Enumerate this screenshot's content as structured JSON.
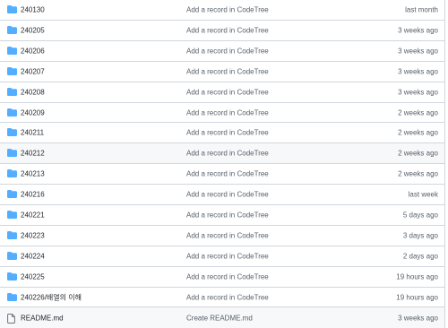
{
  "colors": {
    "folder": "#54aeff",
    "file": "#57606a",
    "border": "#d0d7de"
  },
  "rows": [
    {
      "type": "folder",
      "icon": "folder-icon",
      "name": "240130",
      "commit": "Add a record in CodeTree",
      "age": "last month"
    },
    {
      "type": "folder",
      "icon": "folder-icon",
      "name": "240205",
      "commit": "Add a record in CodeTree",
      "age": "3 weeks ago"
    },
    {
      "type": "folder",
      "icon": "folder-icon",
      "name": "240206",
      "commit": "Add a record in CodeTree",
      "age": "3 weeks ago"
    },
    {
      "type": "folder",
      "icon": "folder-icon",
      "name": "240207",
      "commit": "Add a record in CodeTree",
      "age": "3 weeks ago"
    },
    {
      "type": "folder",
      "icon": "folder-icon",
      "name": "240208",
      "commit": "Add a record in CodeTree",
      "age": "3 weeks ago"
    },
    {
      "type": "folder",
      "icon": "folder-icon",
      "name": "240209",
      "commit": "Add a record in CodeTree",
      "age": "2 weeks ago"
    },
    {
      "type": "folder",
      "icon": "folder-icon",
      "name": "240211",
      "commit": "Add a record in CodeTree",
      "age": "2 weeks ago"
    },
    {
      "type": "folder",
      "icon": "folder-icon",
      "name": "240212",
      "commit": "Add a record in CodeTree",
      "age": "2 weeks ago"
    },
    {
      "type": "folder",
      "icon": "folder-icon",
      "name": "240213",
      "commit": "Add a record in CodeTree",
      "age": "2 weeks ago"
    },
    {
      "type": "folder",
      "icon": "folder-icon",
      "name": "240216",
      "commit": "Add a record in CodeTree",
      "age": "last week"
    },
    {
      "type": "folder",
      "icon": "folder-icon",
      "name": "240221",
      "commit": "Add a record in CodeTree",
      "age": "5 days ago"
    },
    {
      "type": "folder",
      "icon": "folder-icon",
      "name": "240223",
      "commit": "Add a record in CodeTree",
      "age": "3 days ago"
    },
    {
      "type": "folder",
      "icon": "folder-icon",
      "name": "240224",
      "commit": "Add a record in CodeTree",
      "age": "2 days ago"
    },
    {
      "type": "folder",
      "icon": "folder-icon",
      "name": "240225",
      "commit": "Add a record in CodeTree",
      "age": "19 hours ago"
    },
    {
      "type": "folder",
      "icon": "folder-icon",
      "name": "240226/배열의 이해",
      "commit": "Add a record in CodeTree",
      "age": "19 hours ago"
    },
    {
      "type": "file",
      "icon": "file-icon",
      "name": "README.md",
      "commit": "Create README.md",
      "age": "3 weeks ago"
    }
  ]
}
